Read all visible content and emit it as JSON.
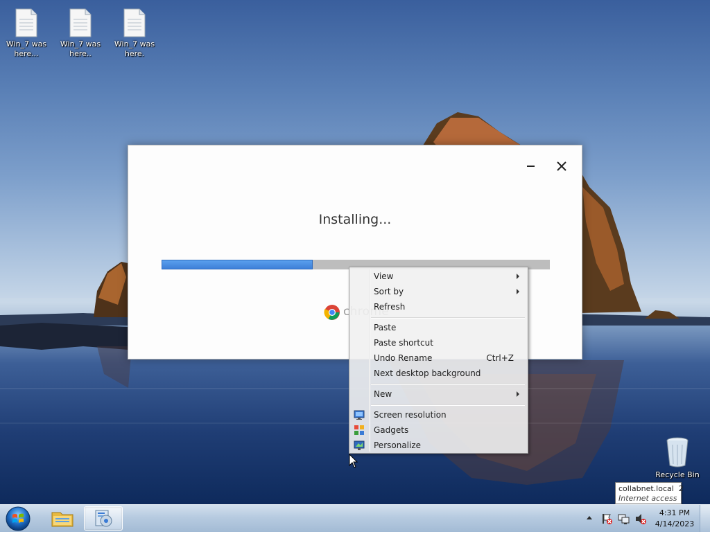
{
  "desktop": {
    "icons": [
      {
        "label": "Win_7 was here..."
      },
      {
        "label": "Win_7 was here.."
      },
      {
        "label": "Win_7 was here."
      }
    ],
    "recycle_bin": {
      "label": "Recycle Bin"
    }
  },
  "installer": {
    "status": "Installing...",
    "progress_percent": 39,
    "brand": "chrome",
    "accent": "#3d7fd8"
  },
  "context_menu": {
    "items": [
      {
        "label": "View",
        "submenu": true
      },
      {
        "label": "Sort by",
        "submenu": true
      },
      {
        "label": "Refresh"
      },
      {
        "label": "Paste"
      },
      {
        "label": "Paste shortcut"
      },
      {
        "label": "Undo Rename",
        "shortcut": "Ctrl+Z"
      },
      {
        "label": "Next desktop background"
      },
      {
        "label": "New",
        "submenu": true
      },
      {
        "label": "Screen resolution",
        "icon": "screen-resolution-icon"
      },
      {
        "label": "Gadgets",
        "icon": "gadgets-icon"
      },
      {
        "label": "Personalize",
        "icon": "personalize-icon"
      }
    ]
  },
  "tooltip": {
    "network": "collabnet.local",
    "network_count": "2",
    "status": "Internet access"
  },
  "taskbar": {
    "clock_time": "4:31 PM",
    "clock_date": "4/14/2023"
  }
}
